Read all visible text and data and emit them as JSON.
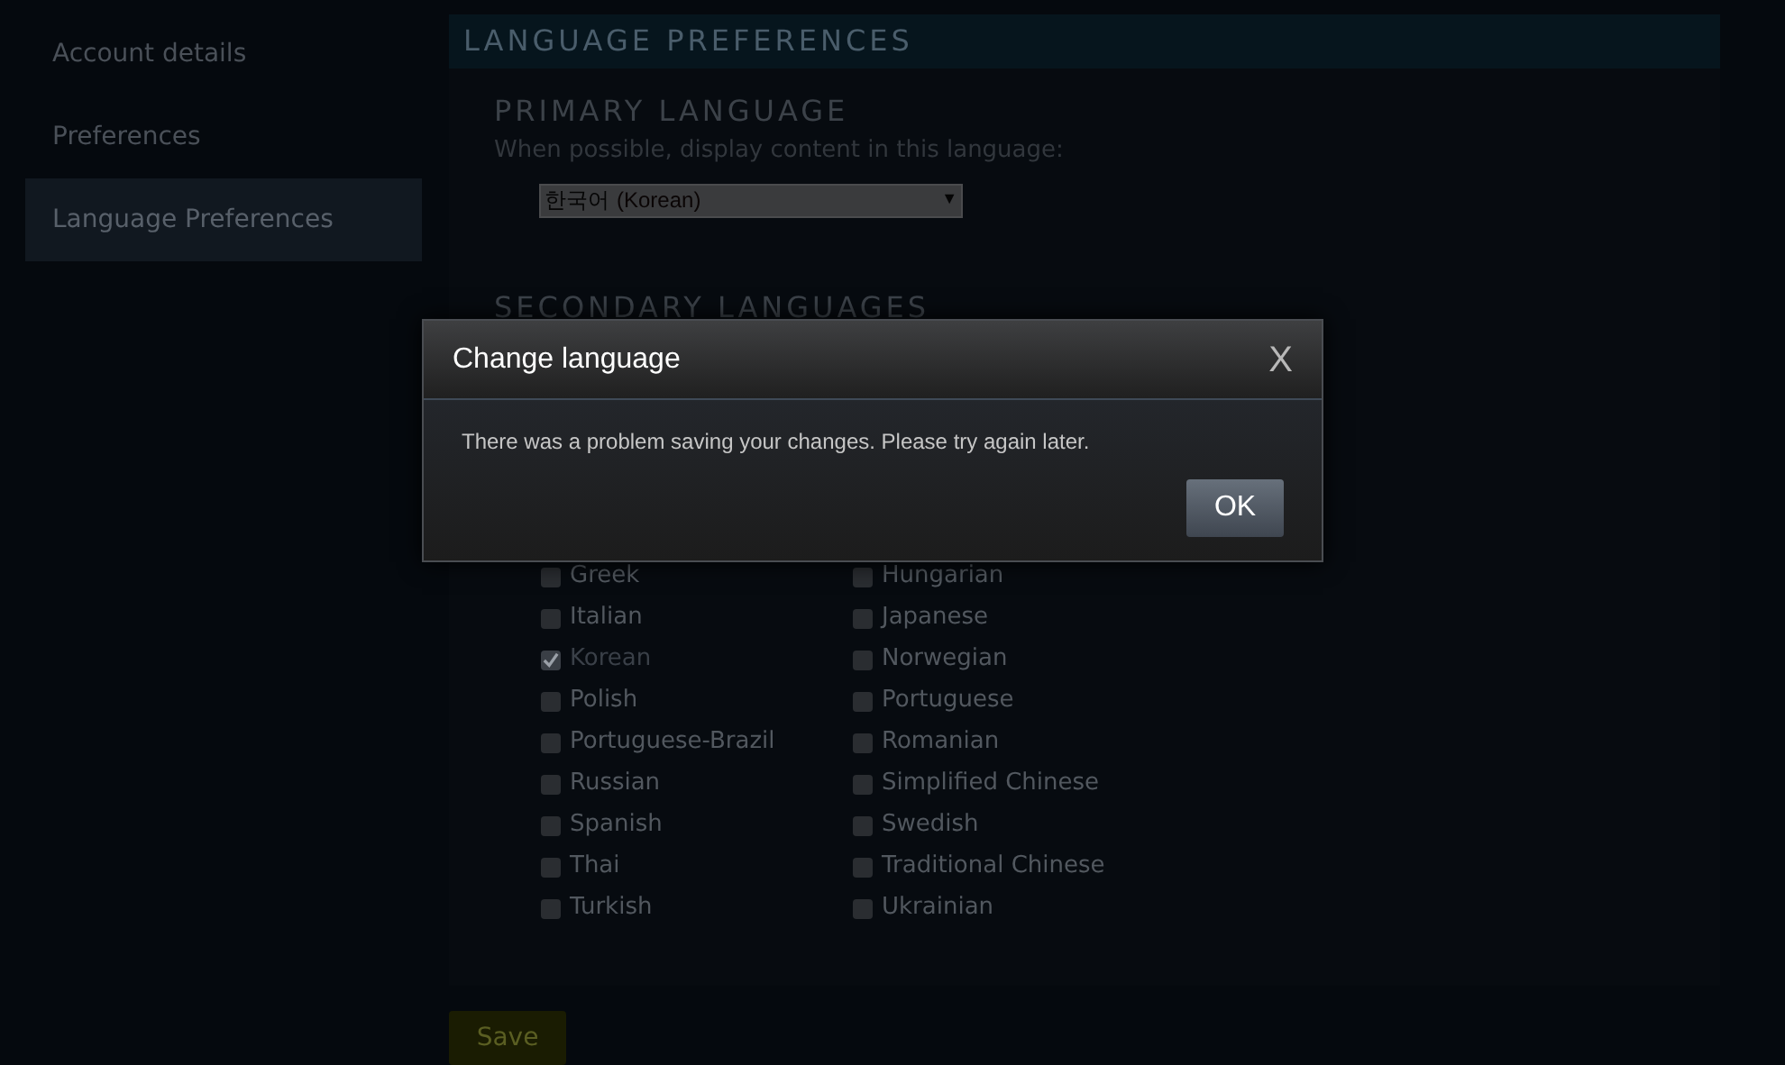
{
  "sidebar": {
    "items": [
      {
        "label": "Account details",
        "selected": false
      },
      {
        "label": "Preferences",
        "selected": false
      },
      {
        "label": "Language Preferences",
        "selected": true
      }
    ]
  },
  "panel": {
    "title": "LANGUAGE PREFERENCES",
    "primary": {
      "heading": "PRIMARY LANGUAGE",
      "hint": "When possible, display content in this language:",
      "select": {
        "native": "한국어",
        "english": "(Korean)",
        "caret": "▼"
      }
    },
    "secondary": {
      "heading": "SECONDARY LANGUAGES",
      "columns": [
        [
          {
            "label": "Greek",
            "checked": false,
            "disabled": false
          },
          {
            "label": "Italian",
            "checked": false,
            "disabled": false
          },
          {
            "label": "Korean",
            "checked": true,
            "disabled": true
          },
          {
            "label": "Polish",
            "checked": false,
            "disabled": false
          },
          {
            "label": "Portuguese-Brazil",
            "checked": false,
            "disabled": false
          },
          {
            "label": "Russian",
            "checked": false,
            "disabled": false
          },
          {
            "label": "Spanish",
            "checked": false,
            "disabled": false
          },
          {
            "label": "Thai",
            "checked": false,
            "disabled": false
          },
          {
            "label": "Turkish",
            "checked": false,
            "disabled": false
          }
        ],
        [
          {
            "label": "Hungarian",
            "checked": false,
            "disabled": false
          },
          {
            "label": "Japanese",
            "checked": false,
            "disabled": false
          },
          {
            "label": "Norwegian",
            "checked": false,
            "disabled": false
          },
          {
            "label": "Portuguese",
            "checked": false,
            "disabled": false
          },
          {
            "label": "Romanian",
            "checked": false,
            "disabled": false
          },
          {
            "label": "Simplified Chinese",
            "checked": false,
            "disabled": false
          },
          {
            "label": "Swedish",
            "checked": false,
            "disabled": false
          },
          {
            "label": "Traditional Chinese",
            "checked": false,
            "disabled": false
          },
          {
            "label": "Ukrainian",
            "checked": false,
            "disabled": false
          }
        ]
      ]
    },
    "save": "Save"
  },
  "dialog": {
    "title": "Change language",
    "close": "X",
    "message": "There was a problem saving your changes. Please try again later.",
    "button": "OK"
  }
}
